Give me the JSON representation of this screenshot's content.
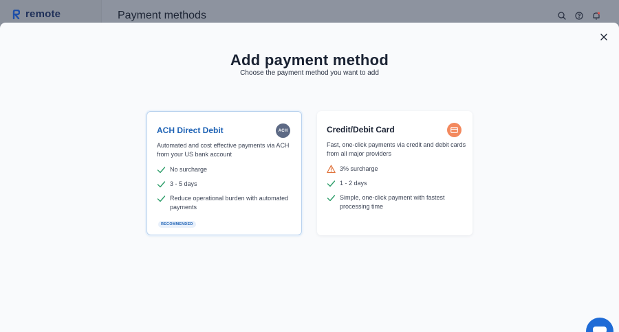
{
  "app": {
    "logo_text": "remote",
    "page_title": "Payment methods"
  },
  "header_icons": [
    "search-icon",
    "help-icon",
    "bell-icon"
  ],
  "modal": {
    "title": "Add payment method",
    "subtitle": "Choose the payment method you want to add",
    "close_icon": "close-icon"
  },
  "options": [
    {
      "title": "ACH Direct Debit",
      "badge": "ACH",
      "selected": true,
      "description": "Automated and cost effective payments via ACH from your US bank account",
      "features": [
        {
          "icon": "check-icon",
          "text": "No surcharge"
        },
        {
          "icon": "check-icon",
          "text": "3 - 5 days"
        },
        {
          "icon": "check-icon",
          "text": "Reduce operational burden with automated payments"
        }
      ],
      "tag": "RECOMMENDED"
    },
    {
      "title": "Credit/Debit Card",
      "badge_icon": "credit-card-icon",
      "selected": false,
      "description": "Fast, one-click payments via credit and debit cards from all major providers",
      "features": [
        {
          "icon": "warning-icon",
          "text": "3% surcharge"
        },
        {
          "icon": "check-icon",
          "text": "1 - 2 days"
        },
        {
          "icon": "check-icon",
          "text": "Simple, one-click payment with fastest processing time"
        }
      ]
    }
  ],
  "colors": {
    "accent": "#1f63b5",
    "check": "#2e9e6a",
    "warning": "#e0733c",
    "card_badge": "#f3895e",
    "ach_badge": "#5d6a85",
    "chat": "#1f6bd6"
  }
}
